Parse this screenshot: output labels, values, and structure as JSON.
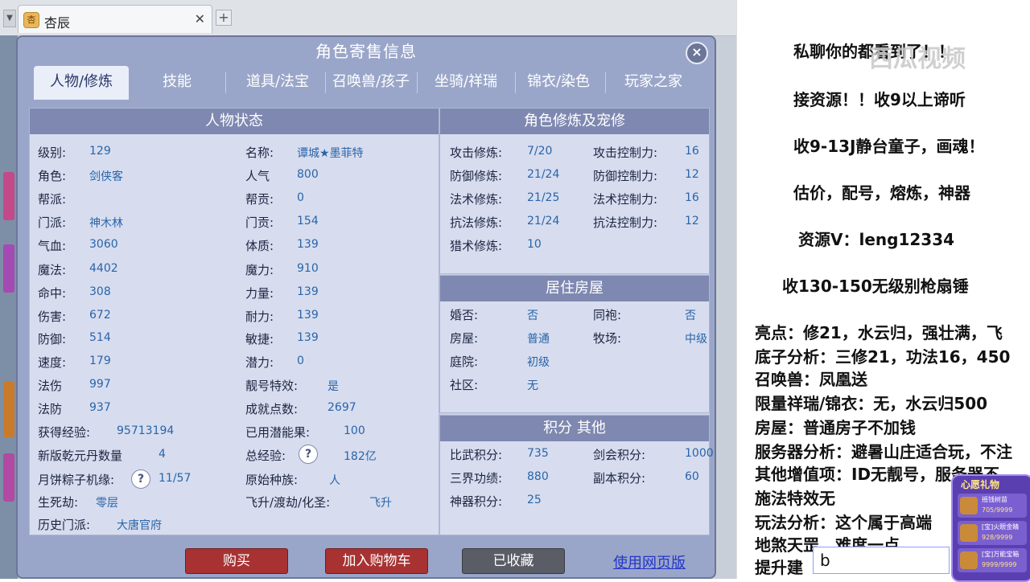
{
  "browser": {
    "tab_title": "杏辰",
    "tab_close": "✕",
    "new_tab": "+",
    "tab_icon": "杏"
  },
  "dialog": {
    "title": "角色寄售信息",
    "close": "×",
    "tabs": [
      "人物/修炼",
      "技能",
      "道具/法宝",
      "召唤兽/孩子",
      "坐骑/祥瑞",
      "锦衣/染色",
      "玩家之家"
    ],
    "active_tab": 0
  },
  "status_panel": {
    "title": "人物状态",
    "left_rows": [
      {
        "label": "级别:",
        "value": "129"
      },
      {
        "label": "角色:",
        "value": "剑侠客"
      },
      {
        "label": "帮派:",
        "value": ""
      },
      {
        "label": "门派:",
        "value": "神木林"
      },
      {
        "label": "气血:",
        "value": "3060"
      },
      {
        "label": "魔法:",
        "value": "4402"
      },
      {
        "label": "命中:",
        "value": "308"
      },
      {
        "label": "伤害:",
        "value": "672"
      },
      {
        "label": "防御:",
        "value": "514"
      },
      {
        "label": "速度:",
        "value": "179"
      },
      {
        "label": "法伤",
        "value": "997"
      },
      {
        "label": "法防",
        "value": "937"
      }
    ],
    "right_rows": [
      {
        "label": "名称:",
        "value": "谭城★墨菲特"
      },
      {
        "label": "人气",
        "value": "800"
      },
      {
        "label": "帮贡:",
        "value": "0"
      },
      {
        "label": "门贡:",
        "value": "154"
      },
      {
        "label": "体质:",
        "value": "139"
      },
      {
        "label": "魔力:",
        "value": "910"
      },
      {
        "label": "力量:",
        "value": "139"
      },
      {
        "label": "耐力:",
        "value": "139"
      },
      {
        "label": "敏捷:",
        "value": "139"
      },
      {
        "label": "潜力:",
        "value": "0"
      },
      {
        "label": "靓号特效:",
        "value": "是"
      },
      {
        "label": "成就点数:",
        "value": "2697"
      }
    ],
    "exp_label": "获得经验:",
    "exp_value": "95713194",
    "qkd_label": "新版乾元丹数量",
    "qkd_value": "4",
    "moon_label": "月饼粽子机缘:",
    "moon_value": "11/57",
    "life_label": "生死劫:",
    "life_value": "零层",
    "history_label": "历史门派:",
    "history_value": "大唐官府",
    "used_label": "已用潜能果:",
    "used_value": "100",
    "total_label": "总经验:",
    "total_value": "182亿",
    "race_label": "原始种族:",
    "race_value": "人",
    "fly_label": "飞升/渡劫/化圣:",
    "fly_value": "飞升",
    "qmark": "?"
  },
  "cultivation_panel": {
    "title": "角色修炼及宠修",
    "rows": [
      {
        "label": "攻击修炼:",
        "value": "7/20",
        "label2": "攻击控制力:",
        "value2": "16"
      },
      {
        "label": "防御修炼:",
        "value": "21/24",
        "label2": "防御控制力:",
        "value2": "12"
      },
      {
        "label": "法术修炼:",
        "value": "21/25",
        "label2": "法术控制力:",
        "value2": "16"
      },
      {
        "label": "抗法修炼:",
        "value": "21/24",
        "label2": "抗法控制力:",
        "value2": "12"
      },
      {
        "label": "猎术修炼:",
        "value": "10",
        "label2": "",
        "value2": ""
      }
    ]
  },
  "house_panel": {
    "title": "居住房屋",
    "rows": [
      {
        "label": "婚否:",
        "value": "否",
        "label2": "同袍:",
        "value2": "否"
      },
      {
        "label": "房屋:",
        "value": "普通",
        "label2": "牧场:",
        "value2": "中级"
      },
      {
        "label": "庭院:",
        "value": "初级",
        "label2": "",
        "value2": ""
      },
      {
        "label": "社区:",
        "value": "无",
        "label2": "",
        "value2": ""
      }
    ]
  },
  "score_panel": {
    "title": "积分 其他",
    "rows": [
      {
        "label": "比武积分:",
        "value": "735",
        "label2": "剑会积分:",
        "value2": "1000"
      },
      {
        "label": "三界功绩:",
        "value": "880",
        "label2": "副本积分:",
        "value2": "60"
      },
      {
        "label": "神器积分:",
        "value": "25",
        "label2": "",
        "value2": ""
      }
    ]
  },
  "actions": {
    "buy": "购买",
    "add_cart": "加入购物车",
    "favorited": "已收藏",
    "web_version": "使用网页版"
  },
  "right_text": {
    "lines": [
      "私聊你的都看到了！！",
      "接资源！！收9以上谛听",
      "收9-13J静台童子，画魂！",
      "估价，配号，熔炼，神器",
      "资源V：leng12334",
      "收130-150无级别枪扇锤",
      "亮点：修21，水云归，强壮满，飞",
      "底子分析：三修21，功法16，450",
      "召唤兽：凤凰送",
      "限量祥瑞/锦衣：无，水云归500",
      "房屋：普通房子不加钱",
      "服务器分析：避暑山庄适合玩，不注",
      "其他增值项：ID无靓号，服务器不",
      "施法特效无",
      "玩法分析：这个属于高端",
      "地煞天罡，难度一点",
      "提升建"
    ],
    "watermark": "西瓜视频",
    "input_value": "b"
  },
  "gift": {
    "title": "心愿礼物",
    "items": [
      {
        "name": "摇钱树苗",
        "count": "705/9999"
      },
      {
        "name": "[宝]火眼金睛",
        "count": "928/9999"
      },
      {
        "name": "[宝]万能宝箱",
        "count": "9999/9999"
      }
    ]
  }
}
